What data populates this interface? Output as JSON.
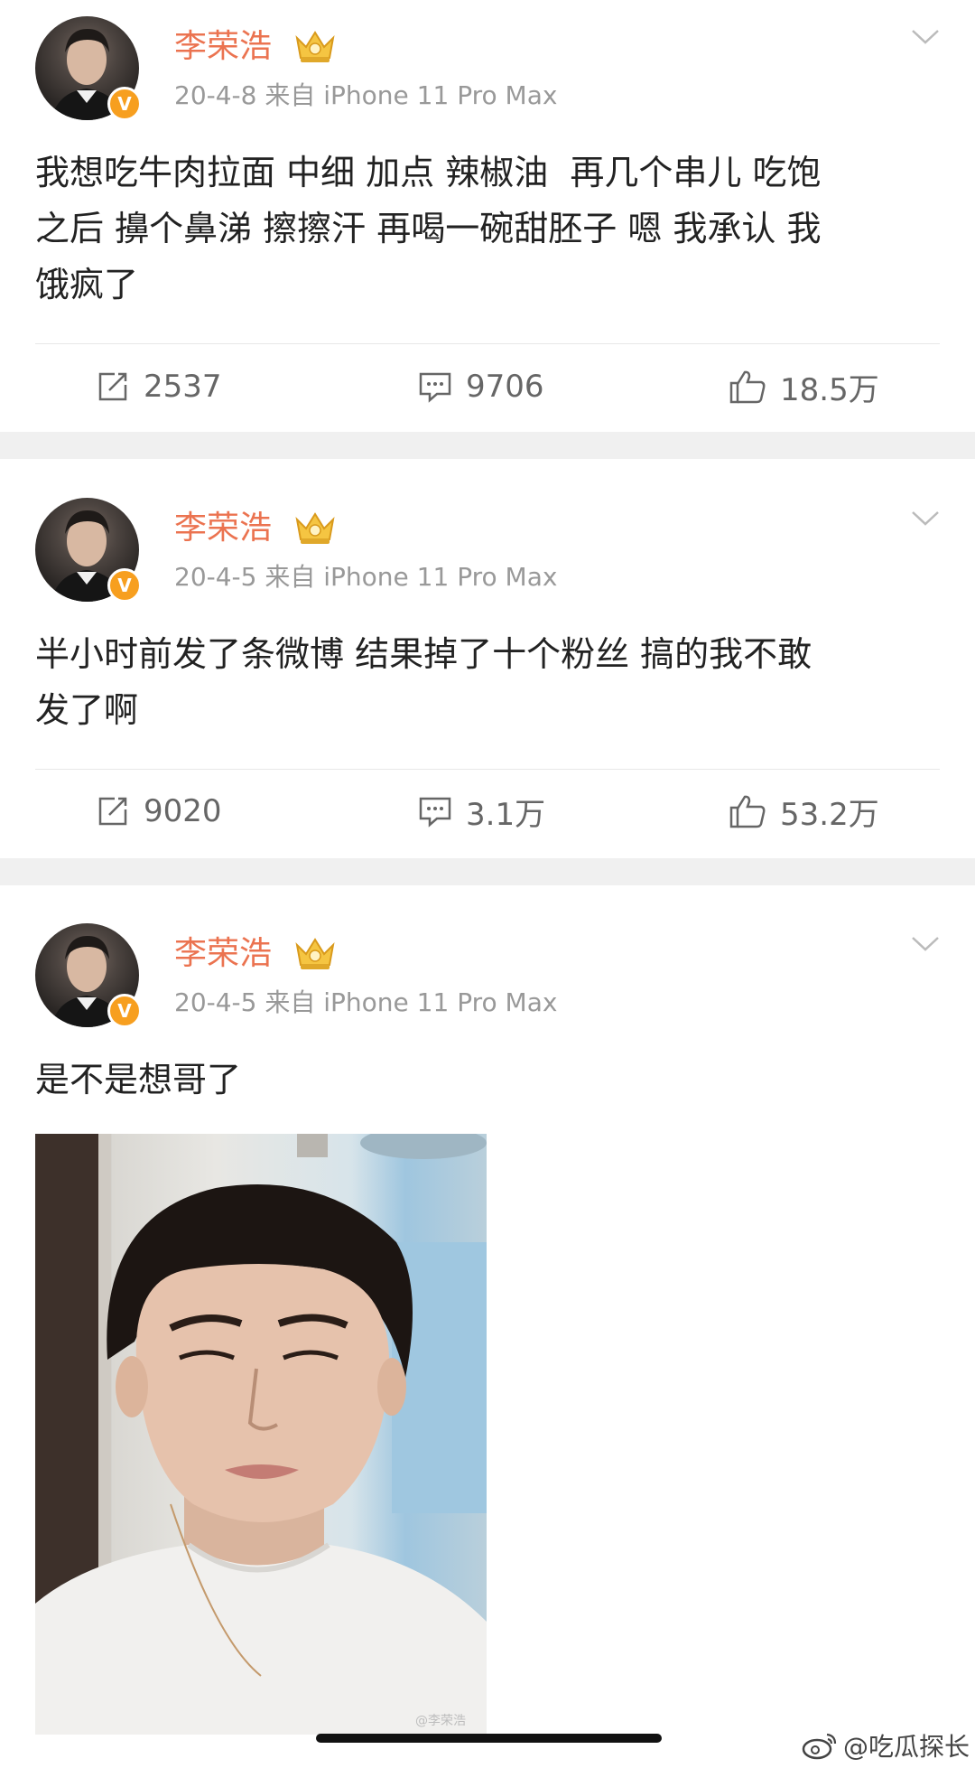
{
  "posts": [
    {
      "author": "李荣浩",
      "meta": "20-4-8  来自 iPhone 11 Pro Max",
      "verified_badge": "V",
      "text": "我想吃牛肉拉面 中细 加点 辣椒油  再几个串儿 吃饱\n之后 擤个鼻涕 擦擦汗 再喝一碗甜胚子 嗯 我承认 我\n饿疯了",
      "repost_count": "2537",
      "comment_count": "9706",
      "like_count": "18.5万"
    },
    {
      "author": "李荣浩",
      "meta": "20-4-5  来自 iPhone 11 Pro Max",
      "verified_badge": "V",
      "text": "半小时前发了条微博 结果掉了十个粉丝 搞的我不敢\n发了啊",
      "repost_count": "9020",
      "comment_count": "3.1万",
      "like_count": "53.2万"
    },
    {
      "author": "李荣浩",
      "meta": "20-4-5  来自 iPhone 11 Pro Max",
      "verified_badge": "V",
      "text": "是不是想哥了",
      "image_watermark": "@李荣浩"
    }
  ],
  "watermark": "@吃瓜探长",
  "colors": {
    "author": "#eb7350",
    "meta": "#999999",
    "separator": "#f0f0f0",
    "badge": "#f79f1f"
  },
  "icons": [
    "crown-icon",
    "chevron-down-icon",
    "repost-icon",
    "comment-icon",
    "like-icon",
    "weibo-logo-icon"
  ]
}
